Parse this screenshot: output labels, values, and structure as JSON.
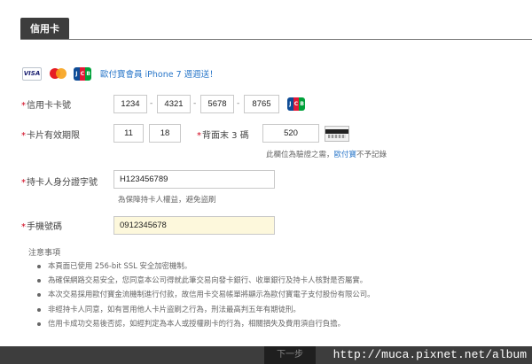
{
  "tab": {
    "label": "信用卡"
  },
  "card_brands": {
    "visa_text": "VISA",
    "jcb_letters": [
      "J",
      "C",
      "B"
    ],
    "promo_text": "歐付寶會員 iPhone 7 週週送！"
  },
  "card_number": {
    "label": "信用卡卡號",
    "segments": [
      "1234",
      "4321",
      "5678",
      "8765"
    ],
    "separator": "-"
  },
  "expiry": {
    "label": "卡片有效期限",
    "month": "11",
    "year": "18"
  },
  "cvv": {
    "label": "背面末 3 碼",
    "value": "520",
    "hint_prefix": "此欄位為驗證之需，",
    "hint_link": "歐付寶",
    "hint_suffix": "不予記錄"
  },
  "id_number": {
    "label": "持卡人身分證字號",
    "value": "H123456789",
    "hint": "為保障持卡人權益，避免盜刷"
  },
  "phone": {
    "label": "手機號碼",
    "value": "0912345678"
  },
  "notes": {
    "title": "注意事項",
    "items": [
      "本頁面已使用 256-bit SSL 安全加密機制。",
      "為確保網路交易安全，您同意本公司得就此筆交易向發卡銀行、收單銀行及持卡人核對是否屬實。",
      "本次交易採用歐付寶金流機制進行付款，故信用卡交易帳單將顯示為歐付寶電子支付股份有限公司。",
      "非經持卡人同意，如有冒用他人卡片盜刷之行為，刑法最高判五年有期徒刑。",
      "信用卡成功交易後否認，如經判定為本人或授權刷卡的行為，相關損失及費用須自行負擔。"
    ]
  },
  "footer": {
    "next_label": "下一步",
    "watermark": "http://muca.pixnet.net/album"
  },
  "colors": {
    "tab_bg": "#3d3d3d",
    "required": "#d0021b",
    "link": "#2a77c9",
    "highlight_field": "#fdf8dc"
  }
}
